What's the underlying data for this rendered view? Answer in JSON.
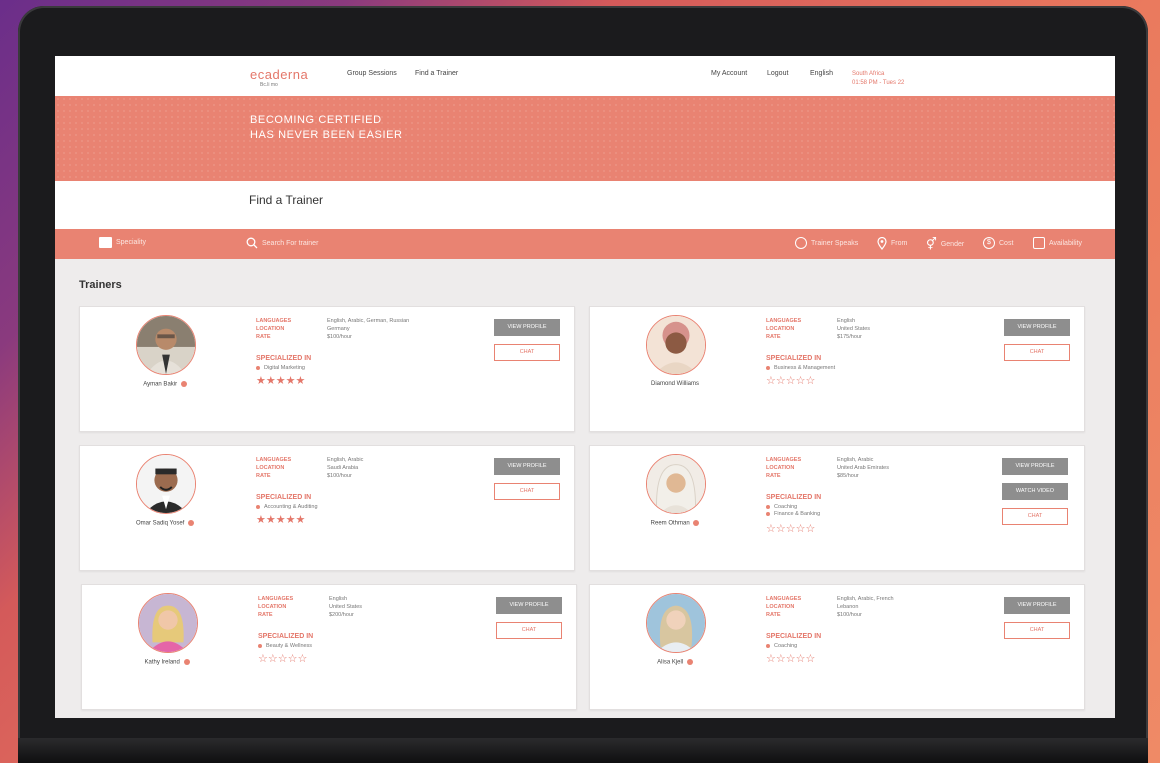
{
  "nav": {
    "logo": "ecaderna",
    "logo_sub": "Bc.li mo",
    "links": [
      "Group Sessions",
      "Find a Trainer"
    ],
    "right_links": [
      "My Account",
      "Logout",
      "English"
    ],
    "region_line1": "South Africa",
    "region_line2": "01:58 PM - Tues 22"
  },
  "hero": {
    "line1": "BECOMING CERTIFIED",
    "line2": "HAS NEVER BEEN EASIER"
  },
  "page_title": "Find a Trainer",
  "filters": {
    "speciality": "Speciality",
    "search_placeholder": "Search For trainer",
    "trainer_speaks": "Trainer Speaks",
    "from": "From",
    "gender": "Gender",
    "cost": "Cost",
    "availability": "Availability"
  },
  "section_title": "Trainers",
  "labels": {
    "languages": "LANGUAGES",
    "location": "LOCATION",
    "rate": "RATE",
    "specialized": "SPECIALIZED IN",
    "view_profile": "VIEW PROFILE",
    "watch_video": "WATCH VIDEO",
    "chat": "CHAT"
  },
  "trainers": [
    {
      "name": "Ayman Bakir",
      "languages": "English, Arabic, German, Russian",
      "location": "Germany",
      "rate": "$100/hour",
      "specialities": [
        "Digital Marketing"
      ],
      "stars": "★★★★★"
    },
    {
      "name": "Diamond Williams",
      "languages": "English",
      "location": "United States",
      "rate": "$175/hour",
      "specialities": [
        "Business & Management"
      ],
      "stars": "☆☆☆☆☆"
    },
    {
      "name": "Omar Sadiq Yosef",
      "languages": "English, Arabic",
      "location": "Saudi Arabia",
      "rate": "$100/hour",
      "specialities": [
        "Accounting & Auditing"
      ],
      "stars": "★★★★★"
    },
    {
      "name": "Reem Othman",
      "languages": "English, Arabic",
      "location": "United Arab Emirates",
      "rate": "$85/hour",
      "specialities": [
        "Coaching",
        "Finance & Banking"
      ],
      "stars": "☆☆☆☆☆"
    },
    {
      "name": "Kathy Ireland",
      "languages": "English",
      "location": "United States",
      "rate": "$200/hour",
      "specialities": [
        "Beauty & Wellness"
      ],
      "stars": "☆☆☆☆☆"
    },
    {
      "name": "Alisa Kjell",
      "languages": "English, Arabic, French",
      "location": "Lebanon",
      "rate": "$100/hour",
      "specialities": [
        "Coaching"
      ],
      "stars": "☆☆☆☆☆"
    }
  ],
  "colors": {
    "accent": "#e98372",
    "button_grey": "#8e8e8e"
  }
}
